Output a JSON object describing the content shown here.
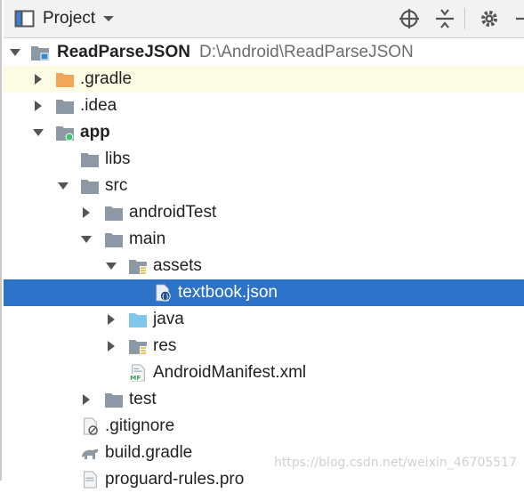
{
  "toolbar": {
    "title": "Project",
    "icons": [
      "dropdown-icon",
      "locate-icon",
      "collapse-all-icon",
      "gear-icon",
      "minimize-icon"
    ]
  },
  "tree": {
    "project": {
      "name": "ReadParseJSON",
      "path": "D:\\Android\\ReadParseJSON"
    },
    "items": [
      {
        "label": ".gradle",
        "icon": "orange-folder"
      },
      {
        "label": ".idea",
        "icon": "gray-folder"
      },
      {
        "label": "app",
        "icon": "module-folder"
      },
      {
        "label": "libs",
        "icon": "gray-folder"
      },
      {
        "label": "src",
        "icon": "gray-folder"
      },
      {
        "label": "androidTest",
        "icon": "gray-folder"
      },
      {
        "label": "main",
        "icon": "gray-folder"
      },
      {
        "label": "assets",
        "icon": "resource-folder"
      },
      {
        "label": "textbook.json",
        "icon": "json-file"
      },
      {
        "label": "java",
        "icon": "source-folder"
      },
      {
        "label": "res",
        "icon": "resource-folder"
      },
      {
        "label": "AndroidManifest.xml",
        "icon": "manifest-file"
      },
      {
        "label": "test",
        "icon": "gray-folder"
      },
      {
        "label": ".gitignore",
        "icon": "ignored-file"
      },
      {
        "label": "build.gradle",
        "icon": "gradle-file"
      },
      {
        "label": "proguard-rules.pro",
        "icon": "text-file"
      }
    ]
  },
  "watermark": "https://blog.csdn.net/weixin_46705517",
  "colors": {
    "selection": "#2b72c8",
    "highlight": "#fcfbe4",
    "folder": "#8c98a4",
    "source_folder": "#7fc8ea",
    "gradle_folder": "#f2a65a",
    "module_dot": "#3ec46d"
  }
}
